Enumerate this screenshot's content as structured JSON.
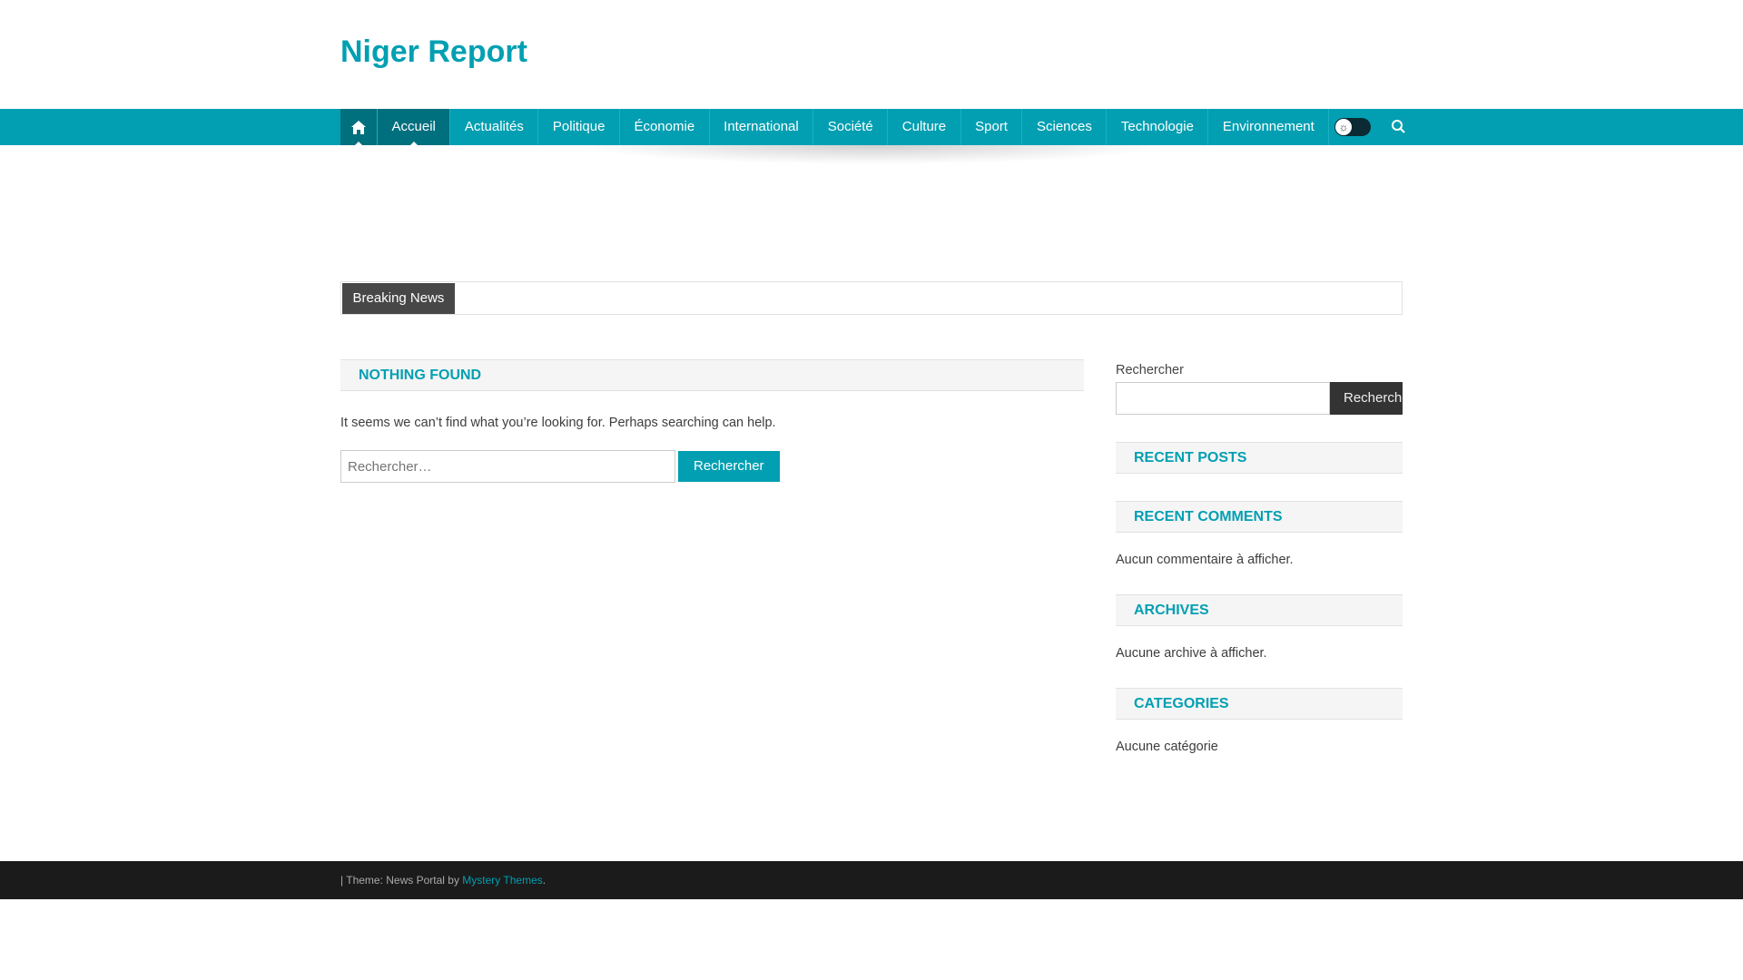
{
  "site": {
    "title": "Niger Report"
  },
  "nav": {
    "items": [
      "Accueil",
      "Actualités",
      "Politique",
      "Économie",
      "International",
      "Société",
      "Culture",
      "Sport",
      "Sciences",
      "Technologie",
      "Environnement"
    ]
  },
  "breaking": {
    "label": "Breaking News"
  },
  "main": {
    "heading": "NOTHING FOUND",
    "message": "It seems we can’t find what you’re looking for. Perhaps searching can help.",
    "search_placeholder": "Rechercher…",
    "search_button": "Rechercher"
  },
  "sidebar": {
    "search_label": "Rechercher",
    "search_button": "Rechercher",
    "widgets": [
      {
        "title": "RECENT POSTS",
        "text": ""
      },
      {
        "title": "RECENT COMMENTS",
        "text": "Aucun commentaire à afficher."
      },
      {
        "title": "ARCHIVES",
        "text": "Aucune archive à afficher."
      },
      {
        "title": "CATEGORIES",
        "text": "Aucune catégorie"
      }
    ]
  },
  "footer": {
    "prefix": "| Theme: News Portal by ",
    "link": "Mystery Themes",
    "suffix": "."
  },
  "colors": {
    "accent": "#029fb2",
    "footer": "#1b1b1b"
  }
}
